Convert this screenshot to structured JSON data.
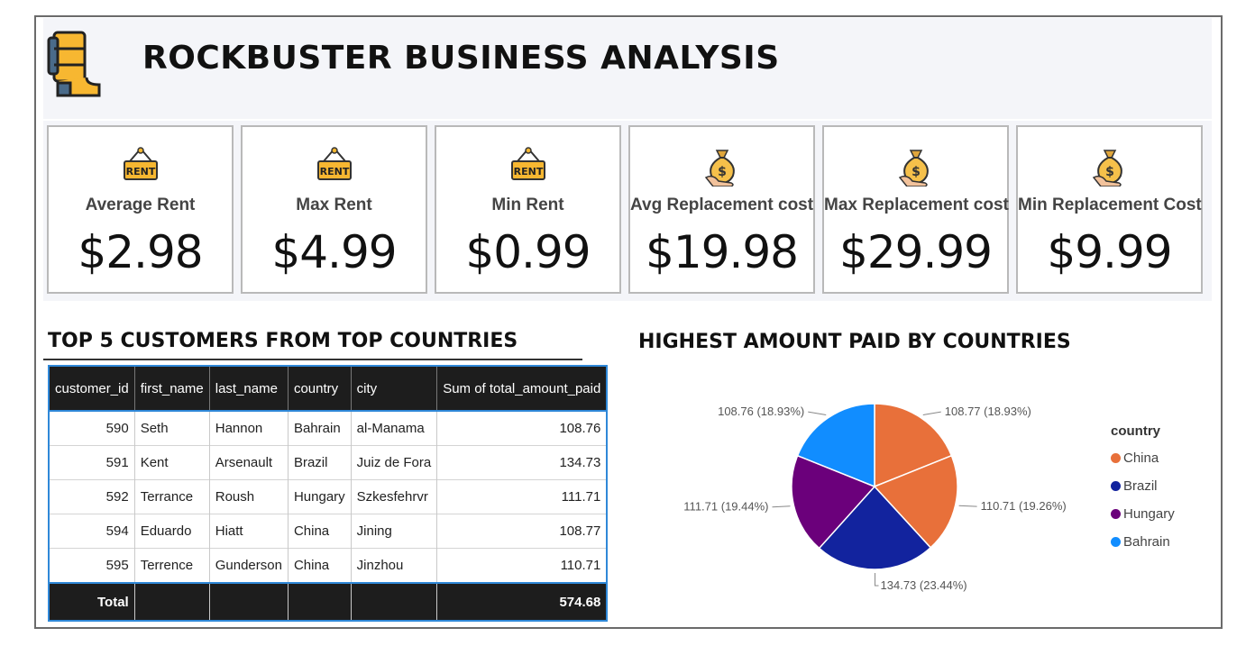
{
  "header": {
    "title": "ROCKBUSTER BUSINESS ANALYSIS",
    "logo_icon": "film-reel-icon"
  },
  "kpis": [
    {
      "label": "Average Rent",
      "value": "$2.98",
      "icon": "rent-sign-icon"
    },
    {
      "label": "Max Rent",
      "value": "$4.99",
      "icon": "rent-sign-icon"
    },
    {
      "label": "Min Rent",
      "value": "$0.99",
      "icon": "rent-sign-icon"
    },
    {
      "label": "Avg Replacement cost",
      "value": "$19.98",
      "icon": "money-bag-icon"
    },
    {
      "label": "Max Replacement cost",
      "value": "$29.99",
      "icon": "money-bag-icon"
    },
    {
      "label": "Min Replacement Cost",
      "value": "$9.99",
      "icon": "money-bag-icon"
    }
  ],
  "table": {
    "title": "TOP 5 CUSTOMERS FROM TOP COUNTRIES",
    "columns": [
      "customer_id",
      "first_name",
      "last_name",
      "country",
      "city",
      "Sum of total_amount_paid"
    ],
    "rows": [
      [
        "590",
        "Seth",
        "Hannon",
        "Bahrain",
        "al-Manama",
        "108.76"
      ],
      [
        "591",
        "Kent",
        "Arsenault",
        "Brazil",
        "Juiz de Fora",
        "134.73"
      ],
      [
        "592",
        "Terrance",
        "Roush",
        "Hungary",
        "Szkesfehrvr",
        "111.71"
      ],
      [
        "594",
        "Eduardo",
        "Hiatt",
        "China",
        "Jining",
        "108.77"
      ],
      [
        "595",
        "Terrence",
        "Gunderson",
        "China",
        "Jinzhou",
        "110.71"
      ]
    ],
    "total_label": "Total",
    "total_value": "574.68"
  },
  "chart_data": {
    "type": "pie",
    "title": "HIGHEST AMOUNT PAID BY COUNTRIES",
    "slices": [
      {
        "label": "108.77 (18.93%)",
        "value": 108.77,
        "color": "#e8703a"
      },
      {
        "label": "110.71 (19.26%)",
        "value": 110.71,
        "color": "#e8703a"
      },
      {
        "label": "134.73 (23.44%)",
        "value": 134.73,
        "color": "#12239e"
      },
      {
        "label": "111.71 (19.44%)",
        "value": 111.71,
        "color": "#6b007b"
      },
      {
        "label": "108.76 (18.93%)",
        "value": 108.76,
        "color": "#118dff"
      }
    ],
    "legend": {
      "title": "country",
      "placement": "right",
      "entries": [
        {
          "name": "China",
          "color": "#e8703a"
        },
        {
          "name": "Brazil",
          "color": "#12239e"
        },
        {
          "name": "Hungary",
          "color": "#6b007b"
        },
        {
          "name": "Bahrain",
          "color": "#118dff"
        }
      ]
    }
  }
}
